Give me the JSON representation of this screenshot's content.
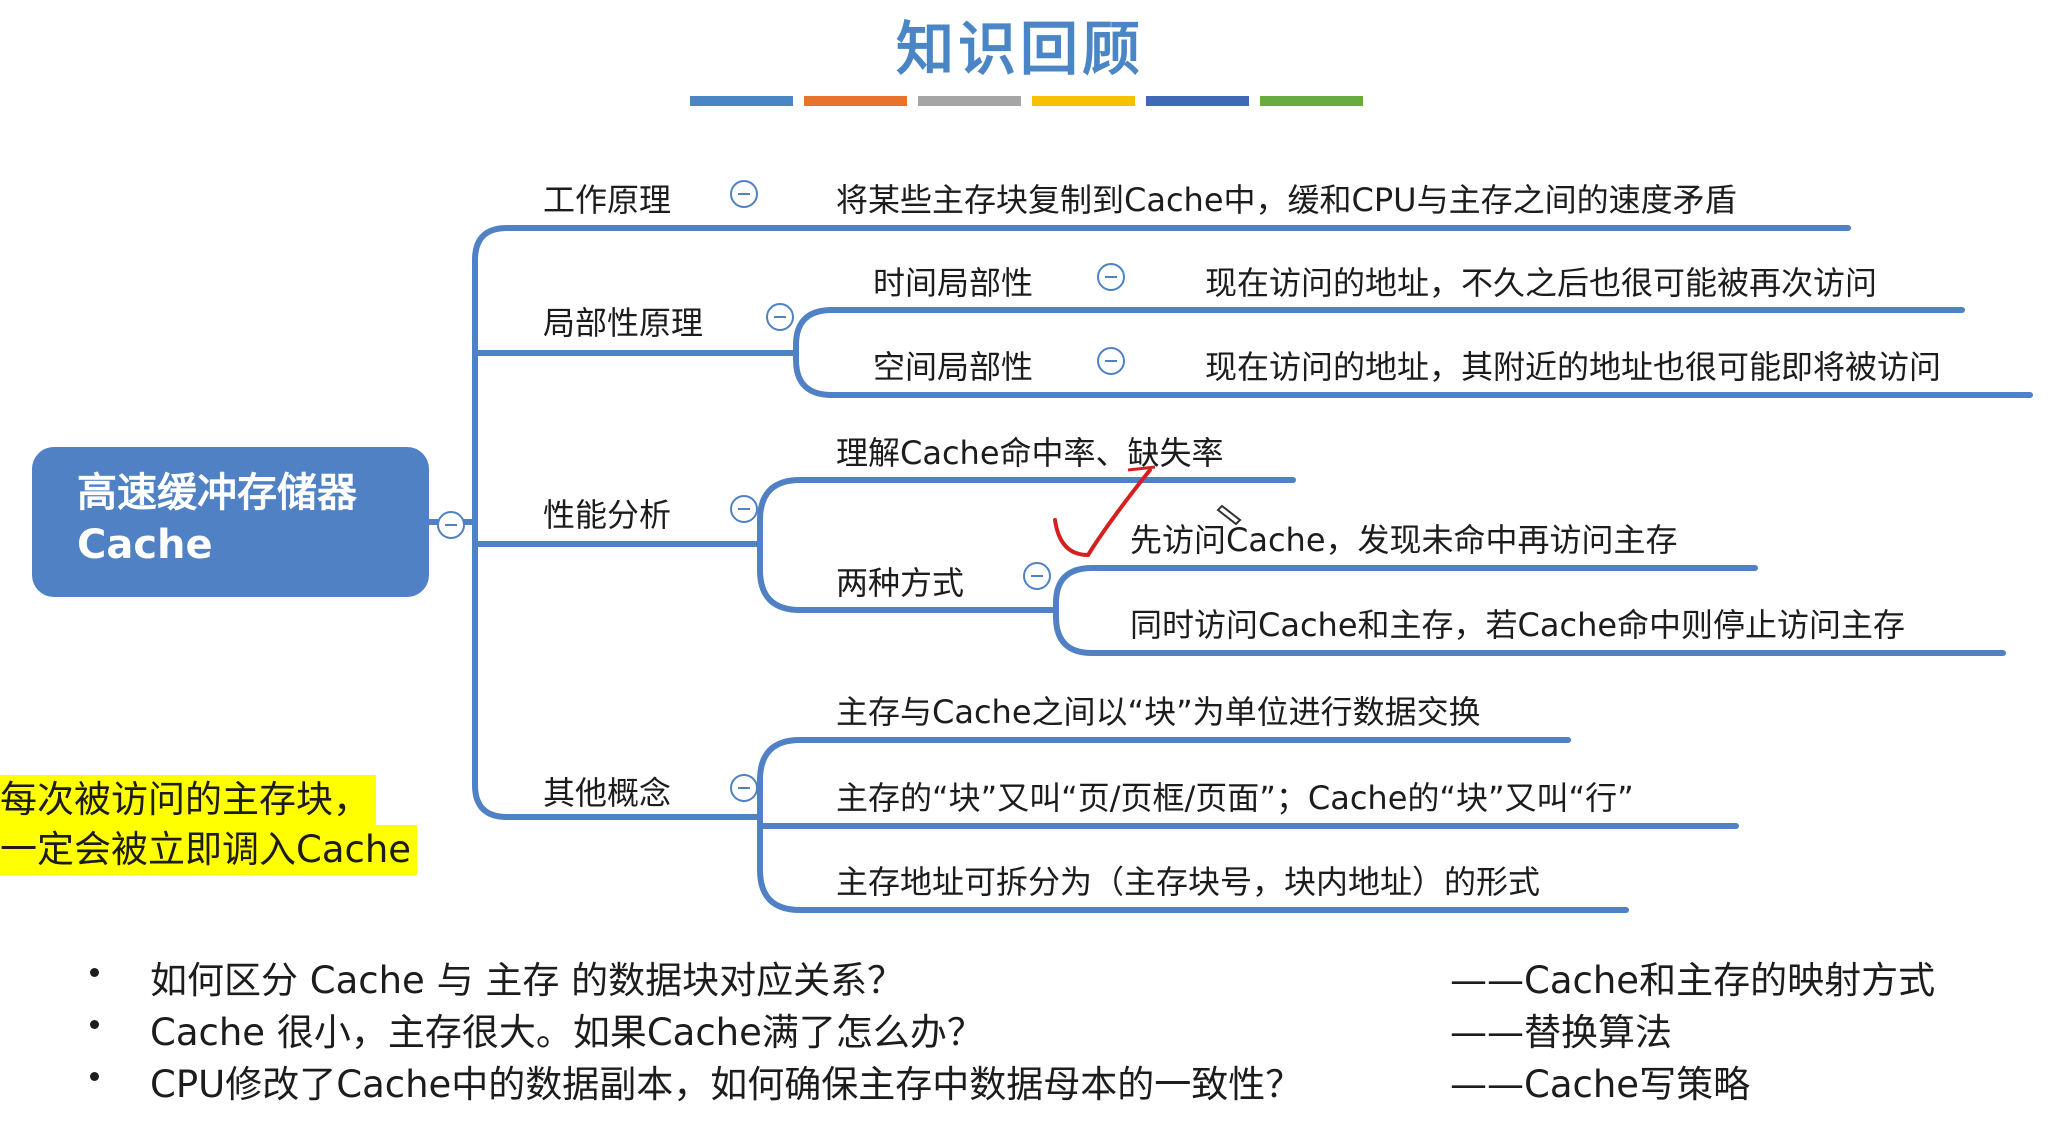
{
  "watermark": "",
  "title": "知识回顾",
  "title_colors": [
    "#4a86c5",
    "#e8742c",
    "#a5a5a5",
    "#f6bf00",
    "#3f69b6",
    "#6aab3f"
  ],
  "root": {
    "line1": "高速缓冲存储器",
    "line2": "Cache"
  },
  "branches": {
    "work_principle": {
      "label": "工作原理",
      "desc": "将某些主存块复制到Cache中，缓和CPU与主存之间的速度矛盾"
    },
    "locality": {
      "label": "局部性原理",
      "temporal": {
        "label": "时间局部性",
        "desc": "现在访问的地址，不久之后也很可能被再次访问"
      },
      "spatial": {
        "label": "空间局部性",
        "desc": "现在访问的地址，其附近的地址也很可能即将被访问"
      }
    },
    "performance": {
      "label": "性能分析",
      "hit_rate": "理解Cache命中率、缺失率",
      "two_ways": {
        "label": "两种方式",
        "way1": "先访问Cache，发现未命中再访问主存",
        "way2": "同时访问Cache和主存，若Cache命中则停止访问主存"
      }
    },
    "other": {
      "label": "其他概念",
      "c1": "主存与Cache之间以“块”为单位进行数据交换",
      "c2": "主存的“块”又叫“页/页框/页面”；Cache的“块”又叫“行”",
      "c3": "主存地址可拆分为（主存块号，块内地址）的形式"
    }
  },
  "highlight": {
    "line1": "每次被访问的主存块，",
    "line2": "一定会被立即调入Cache"
  },
  "questions": [
    {
      "q": "如何区分 Cache 与 主存 的数据块对应关系？",
      "a": "——Cache和主存的映射方式"
    },
    {
      "q": "Cache 很小，主存很大。如果Cache满了怎么办？",
      "a": "——替换算法"
    },
    {
      "q": "CPU修改了Cache中的数据副本，如何确保主存中数据母本的一致性？",
      "a": "——Cache写策略"
    }
  ]
}
